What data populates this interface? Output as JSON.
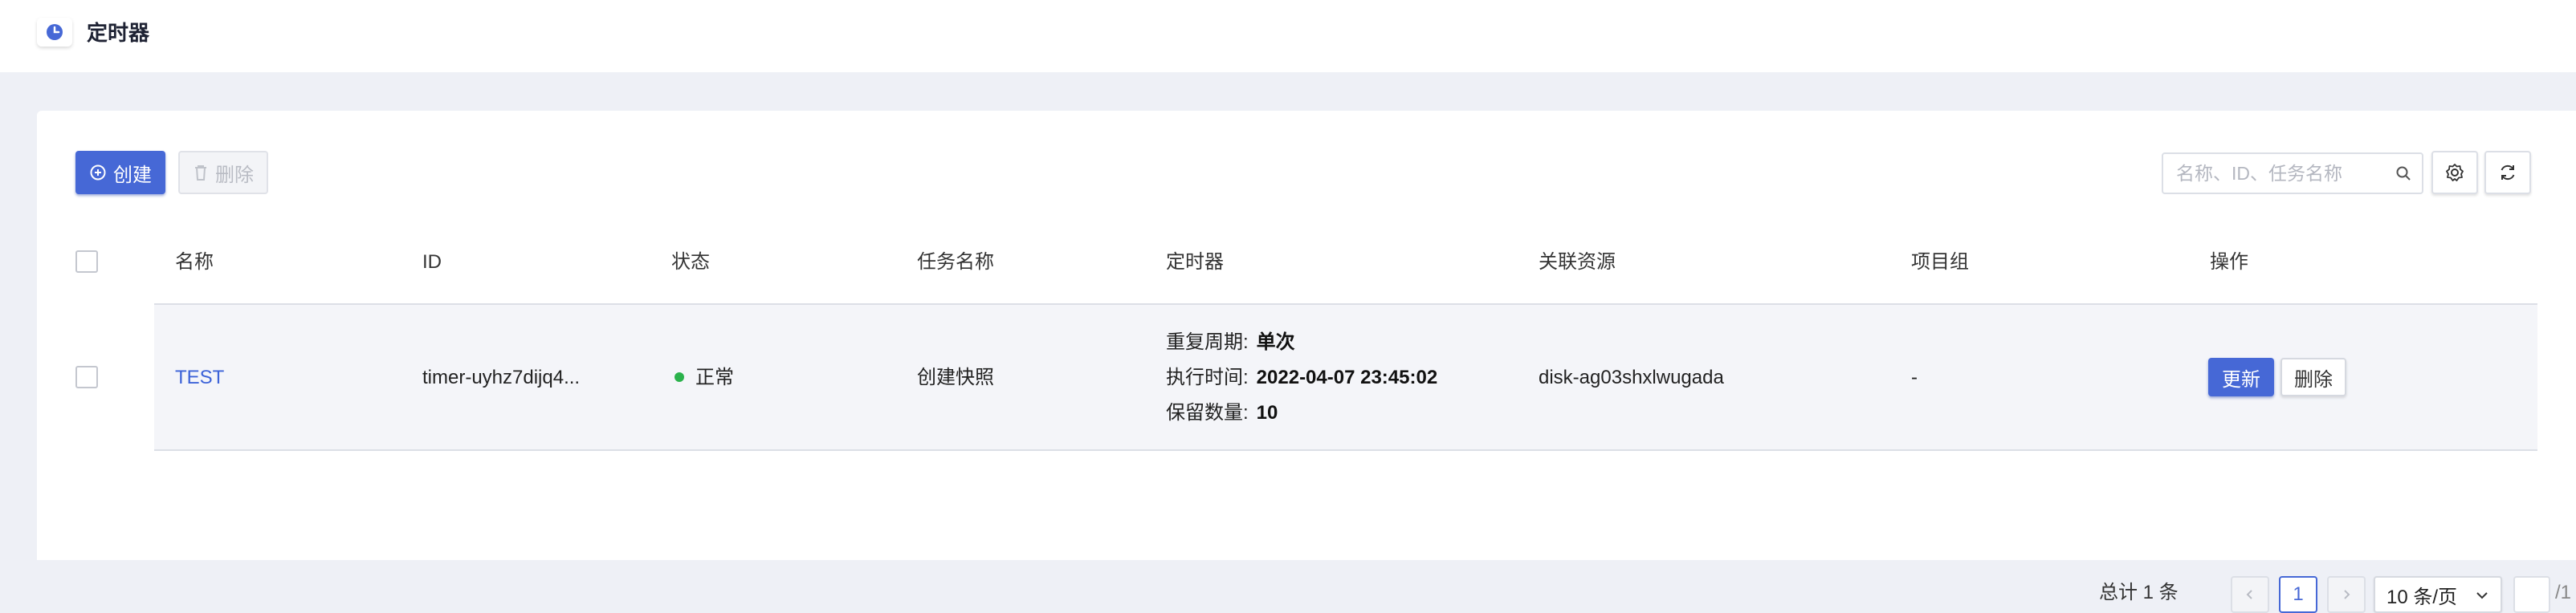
{
  "header": {
    "title": "定时器",
    "icon": "clock-icon"
  },
  "toolbar": {
    "create_label": "创建",
    "delete_label": "删除",
    "search_placeholder": "名称、ID、任务名称",
    "search_value": ""
  },
  "table": {
    "columns": [
      "名称",
      "ID",
      "状态",
      "任务名称",
      "定时器",
      "关联资源",
      "项目组",
      "操作"
    ],
    "rows": [
      {
        "name": "TEST",
        "id": "timer-uyhz7dijq4...",
        "status": "正常",
        "status_color": "#2bb24c",
        "task_name": "创建快照",
        "timer": {
          "repeat_label": "重复周期:",
          "repeat_value": "单次",
          "exec_label": "执行时间:",
          "exec_value": "2022-04-07 23:45:02",
          "keep_label": "保留数量:",
          "keep_value": "10"
        },
        "resource": "disk-ag03shxlwugada",
        "project": "-",
        "actions": {
          "update": "更新",
          "delete": "删除"
        }
      }
    ]
  },
  "pagination": {
    "total": "总计 1 条",
    "current_page": "1",
    "page_size": "10 条/页",
    "jump_value": "",
    "total_pages": "/1"
  },
  "colors": {
    "primary": "#4668d6",
    "link": "#3d63d8",
    "background": "#eef0f6"
  }
}
